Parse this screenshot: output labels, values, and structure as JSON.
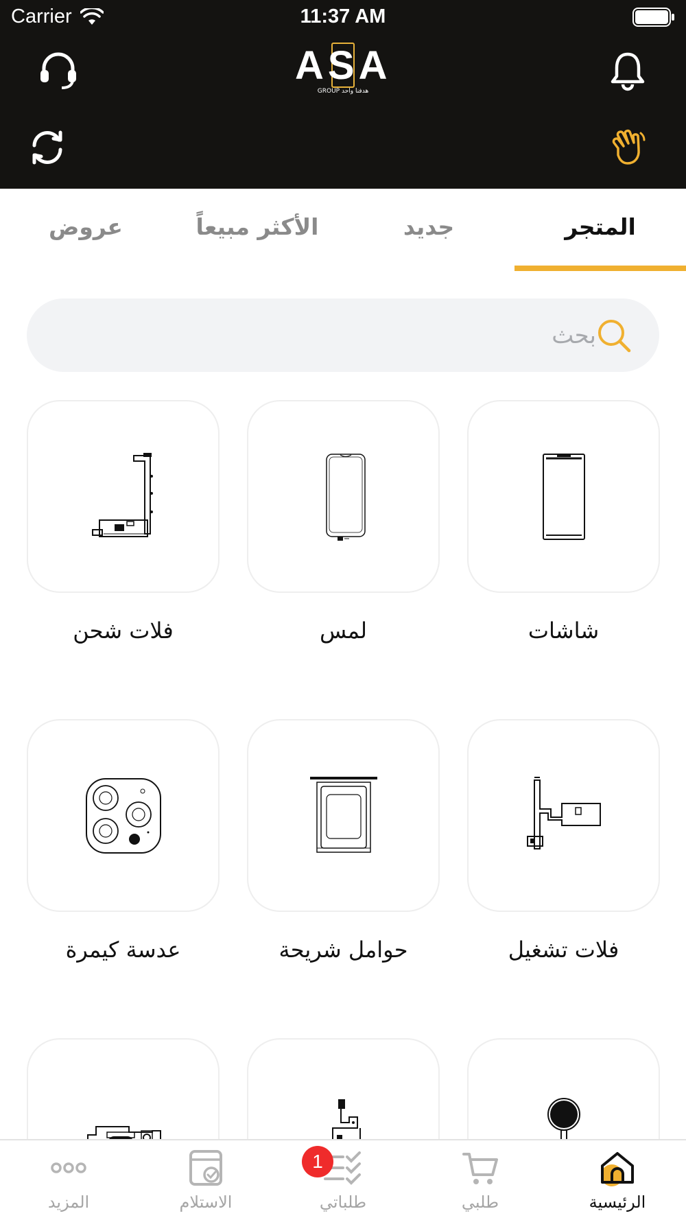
{
  "status_bar": {
    "carrier": "Carrier",
    "time": "11:37 AM"
  },
  "header": {
    "logo_text": "ASA",
    "logo_subtext": "GROUP هدفنا واحد"
  },
  "tabs": [
    {
      "label": "المتجر",
      "active": true
    },
    {
      "label": "جديد",
      "active": false
    },
    {
      "label": "الأكثر مبيعاً",
      "active": false
    },
    {
      "label": "عروض",
      "active": false
    }
  ],
  "search": {
    "placeholder": "بحث",
    "value": ""
  },
  "categories": [
    {
      "label": "شاشات",
      "icon": "screen-icon"
    },
    {
      "label": "لمس",
      "icon": "touch-icon"
    },
    {
      "label": "فلات شحن",
      "icon": "charging-flex-icon"
    },
    {
      "label": "فلات تشغيل",
      "icon": "power-flex-icon"
    },
    {
      "label": "حوامل شريحة",
      "icon": "sim-tray-icon"
    },
    {
      "label": "عدسة كيمرة",
      "icon": "camera-lens-icon"
    },
    {
      "label": "",
      "icon": "home-button-icon"
    },
    {
      "label": "",
      "icon": "flex-board-icon"
    },
    {
      "label": "",
      "icon": "camera-module-icon"
    }
  ],
  "bottom_nav": [
    {
      "label": "الرئيسية",
      "icon": "home-icon",
      "active": true
    },
    {
      "label": "طلبي",
      "icon": "cart-icon",
      "active": false
    },
    {
      "label": "طلباتي",
      "icon": "orders-icon",
      "active": false,
      "badge": "1"
    },
    {
      "label": "الاستلام",
      "icon": "receive-icon",
      "active": false
    },
    {
      "label": "المزيد",
      "icon": "more-icon",
      "active": false
    }
  ],
  "colors": {
    "header_bg": "#141311",
    "accent": "#f0b030",
    "badge": "#ef2b2b"
  }
}
